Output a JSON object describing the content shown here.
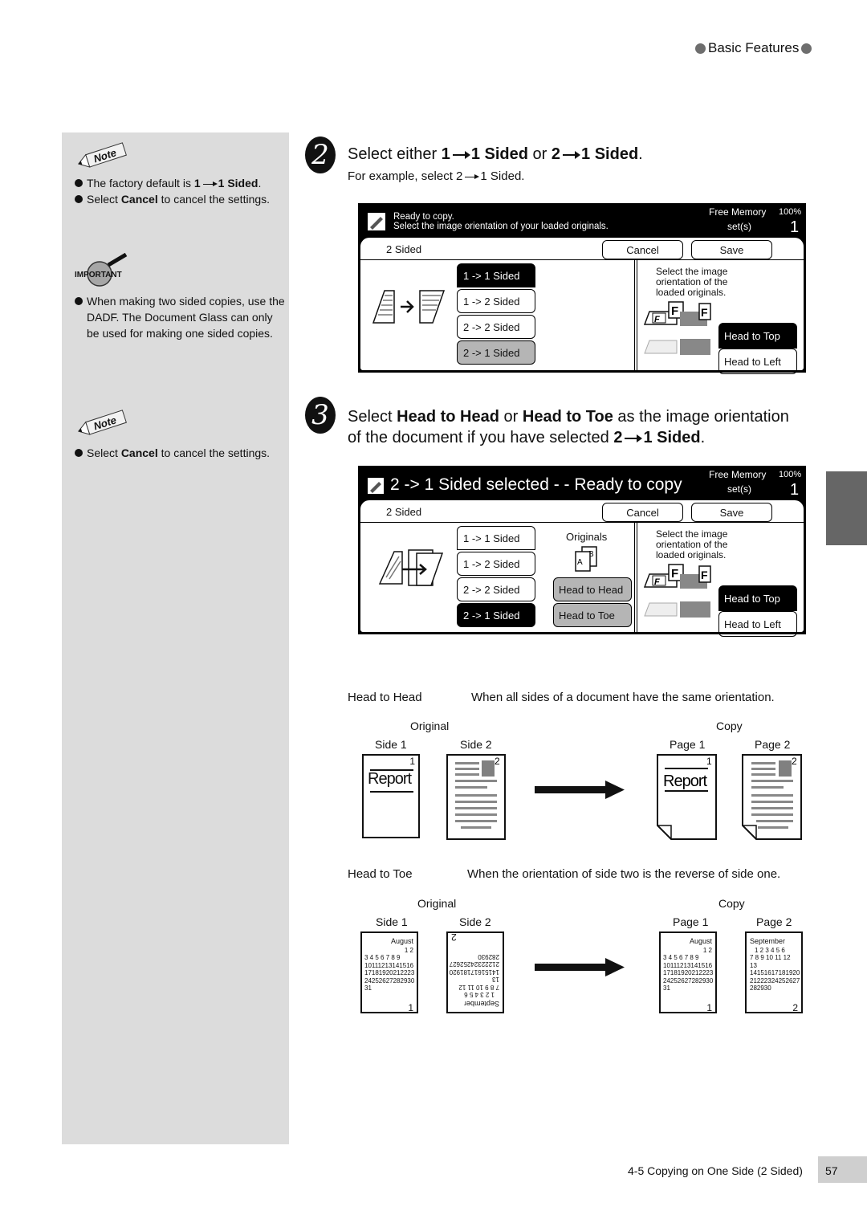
{
  "header": {
    "section": "Basic Features"
  },
  "sidebar": {
    "note1": {
      "badge": "Note",
      "items": [
        {
          "pre": "The factory default is ",
          "bold": "1",
          "arrow": true,
          "bold2": "1 Sided",
          "post": "."
        },
        {
          "pre": "Select ",
          "bold": "Cancel",
          "post": " to cancel the settings."
        }
      ]
    },
    "important": {
      "badge": "IMPORTANT",
      "items": [
        {
          "text": "When making two sided copies, use the DADF.  The Document Glass can only be used for making one sided copies."
        }
      ]
    },
    "note2": {
      "badge": "Note",
      "items": [
        {
          "pre": "Select ",
          "bold": "Cancel",
          "post": " to cancel the settings."
        }
      ]
    }
  },
  "step2": {
    "number": "2",
    "title_pre": "Select either ",
    "opt1_a": "1",
    "opt1_b": "1 Sided",
    "or": " or ",
    "opt2_a": "2",
    "opt2_b": "1 Sided",
    "end": ".",
    "sub_pre": "For example, select 2",
    "sub_post": "1 Sided."
  },
  "panel1": {
    "status_line1": "Ready to copy.",
    "status_line2": "Select the image orientation of your loaded originals.",
    "free_memory_label": "Free Memory",
    "free_memory_value": "100%",
    "sets_label": "set(s)",
    "sets_value": "1",
    "mode_label": "2 Sided",
    "cancel": "Cancel",
    "save": "Save",
    "options": [
      "1 -> 1 Sided",
      "1 -> 2 Sided",
      "2 -> 2 Sided",
      "2 -> 1 Sided"
    ],
    "selected_option": "1 -> 1 Sided",
    "instruction": [
      "Select the image",
      "orientation of the",
      "loaded originals."
    ],
    "orient_top": "Head to Top",
    "orient_left": "Head to Left"
  },
  "step3": {
    "number": "3",
    "pre": "Select ",
    "b1": "Head to Head",
    "mid": " or ",
    "b2": "Head to Toe",
    "post": " as the image orientation",
    "line2_pre": "of the document if you have selected ",
    "line2_a": "2",
    "line2_b": "1 Sided",
    "line2_end": "."
  },
  "panel2": {
    "status_title": "2 -> 1 Sided selected - - Ready to copy",
    "free_memory_label": "Free Memory",
    "free_memory_value": "100%",
    "sets_label": "set(s)",
    "sets_value": "1",
    "mode_label": "2 Sided",
    "cancel": "Cancel",
    "save": "Save",
    "options": [
      "1 -> 1 Sided",
      "1 -> 2 Sided",
      "2 -> 2 Sided",
      "2 -> 1 Sided"
    ],
    "selected_option": "2 -> 1 Sided",
    "originals_label": "Originals",
    "head_to_head": "Head to Head",
    "head_to_toe": "Head to Toe",
    "instruction": [
      "Select the image",
      "orientation of the",
      "loaded originals."
    ],
    "orient_top": "Head to Top",
    "orient_left": "Head to Left"
  },
  "head_to_head": {
    "term": "Head to Head",
    "desc": "When all sides of a document have the same orientation.",
    "original": "Original",
    "copy": "Copy",
    "side1": "Side 1",
    "side2": "Side 2",
    "page1": "Page 1",
    "page2": "Page 2",
    "report": "Report",
    "n1": "1",
    "n2": "2"
  },
  "head_to_toe": {
    "term": "Head to Toe",
    "desc": "When the orientation of side two is the reverse of side one.",
    "original": "Original",
    "copy": "Copy",
    "side1": "Side 1",
    "side2": "Side 2",
    "page1": "Page 1",
    "page2": "Page 2",
    "august": "August",
    "august_rows": [
      "1 2",
      "3 4 5 6 7  8  9",
      "10111213141516",
      "17181920212223",
      "24252627282930",
      "31"
    ],
    "september": "September",
    "september_rows": [
      "1  2  3 4 5 6",
      "7 8 9 10 11 12 13",
      "14151617181920",
      "21222324252627",
      "282930"
    ],
    "n1": "1",
    "n2": "2"
  },
  "footer": {
    "section": "4-5  Copying on One Side (2 Sided)",
    "page": "57"
  }
}
